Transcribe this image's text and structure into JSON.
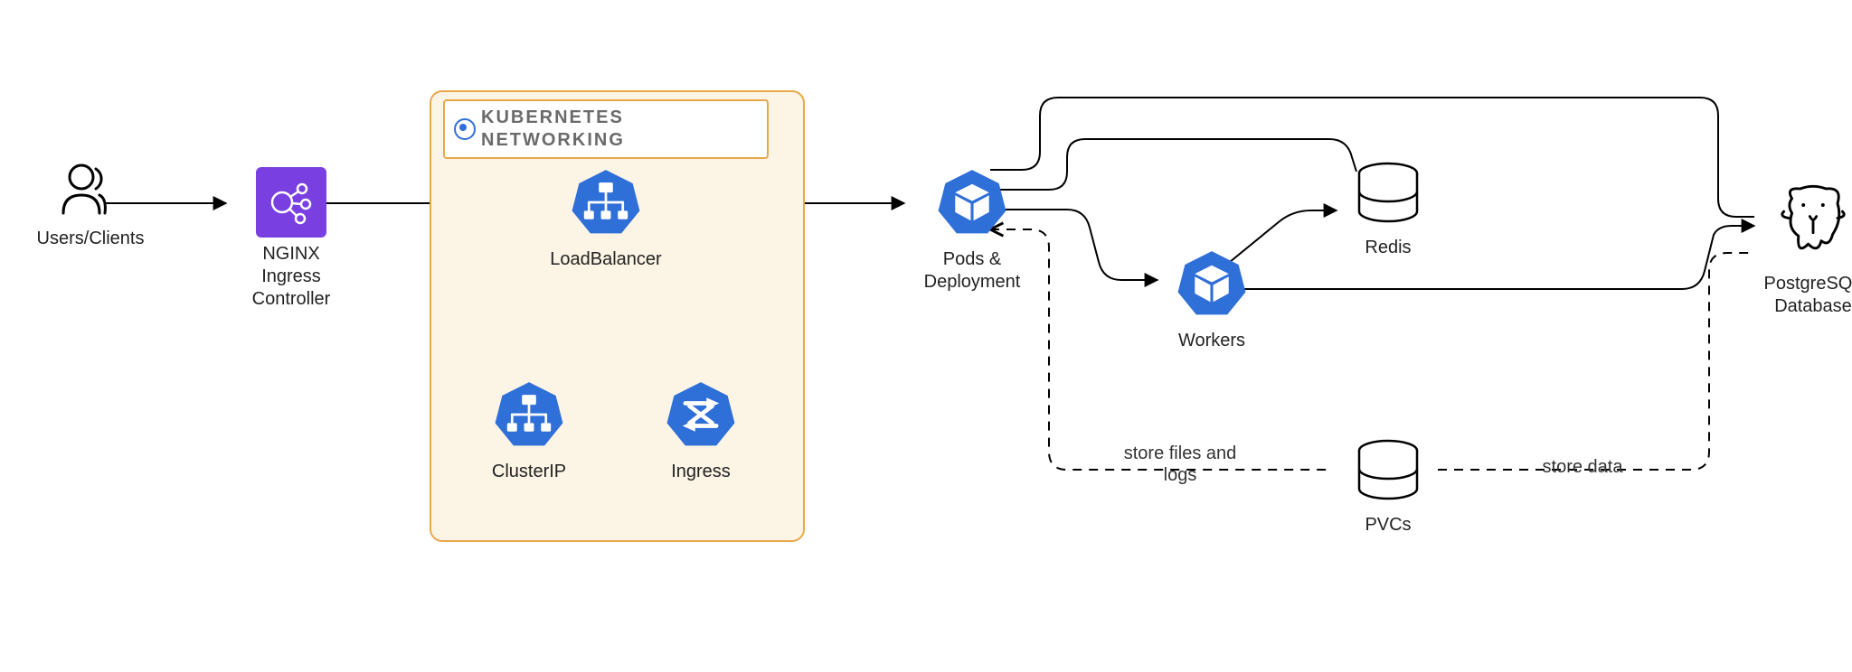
{
  "nodes": {
    "users": {
      "label": "Users/Clients"
    },
    "nginx": {
      "label": "NGINX\nIngress\nController"
    },
    "loadbalancer": {
      "label": "LoadBalancer"
    },
    "clusterip": {
      "label": "ClusterIP"
    },
    "ingress": {
      "label": "Ingress"
    },
    "pods": {
      "label": "Pods &\nDeployment"
    },
    "workers": {
      "label": "Workers"
    },
    "redis": {
      "label": "Redis"
    },
    "pvcs": {
      "label": "PVCs"
    },
    "postgres": {
      "label": "PostgreSQL\nDatabase"
    }
  },
  "group": {
    "title": "KUBERNETES\nNETWORKING"
  },
  "edges": {
    "store_files": "store files and\nlogs",
    "store_data": "store data"
  },
  "colors": {
    "k8s_blue": "#2f6fd8",
    "nginx_purple": "#7a3fe0",
    "group_border": "#e8a84a",
    "group_fill": "#fcf5e6"
  }
}
